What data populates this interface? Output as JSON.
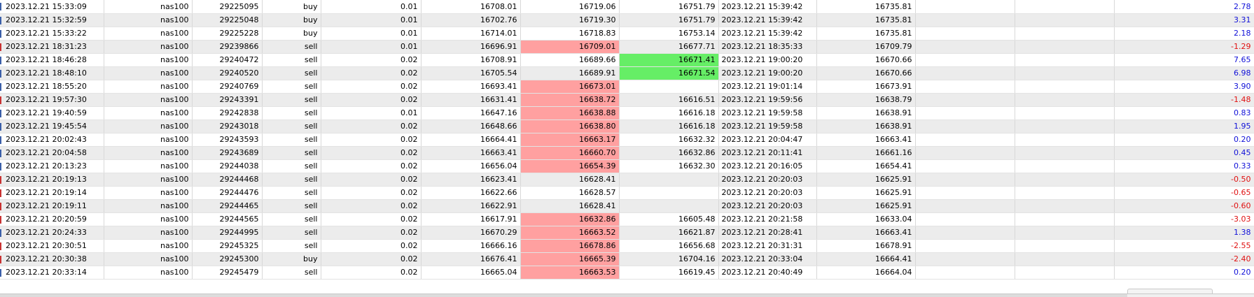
{
  "rows": [
    {
      "open_time": "2023.12.21 15:33:09",
      "symbol": "nas100",
      "ticket": "29225095",
      "type": "buy",
      "volume": "0.01",
      "open_price": "16708.01",
      "sl": "16719.06",
      "tp": "16751.79",
      "close_time": "2023.12.21 15:39:42",
      "close_price": "16735.81",
      "profit": "2.78",
      "sl_highlight": "",
      "tp_highlight": ""
    },
    {
      "open_time": "2023.12.21 15:32:59",
      "symbol": "nas100",
      "ticket": "29225048",
      "type": "buy",
      "volume": "0.01",
      "open_price": "16702.76",
      "sl": "16719.30",
      "tp": "16751.79",
      "close_time": "2023.12.21 15:39:42",
      "close_price": "16735.81",
      "profit": "3.31",
      "sl_highlight": "",
      "tp_highlight": ""
    },
    {
      "open_time": "2023.12.21 15:33:22",
      "symbol": "nas100",
      "ticket": "29225228",
      "type": "buy",
      "volume": "0.01",
      "open_price": "16714.01",
      "sl": "16718.83",
      "tp": "16753.14",
      "close_time": "2023.12.21 15:39:42",
      "close_price": "16735.81",
      "profit": "2.18",
      "sl_highlight": "",
      "tp_highlight": ""
    },
    {
      "open_time": "2023.12.21 18:31:23",
      "symbol": "nas100",
      "ticket": "29239866",
      "type": "sell",
      "volume": "0.01",
      "open_price": "16696.91",
      "sl": "16709.01",
      "tp": "16677.71",
      "close_time": "2023.12.21 18:35:33",
      "close_price": "16709.79",
      "profit": "-1.29",
      "sl_highlight": "red",
      "tp_highlight": ""
    },
    {
      "open_time": "2023.12.21 18:46:28",
      "symbol": "nas100",
      "ticket": "29240472",
      "type": "sell",
      "volume": "0.02",
      "open_price": "16708.91",
      "sl": "16689.66",
      "tp": "16671.41",
      "close_time": "2023.12.21 19:00:20",
      "close_price": "16670.66",
      "profit": "7.65",
      "sl_highlight": "",
      "tp_highlight": "green"
    },
    {
      "open_time": "2023.12.21 18:48:10",
      "symbol": "nas100",
      "ticket": "29240520",
      "type": "sell",
      "volume": "0.02",
      "open_price": "16705.54",
      "sl": "16689.91",
      "tp": "16671.54",
      "close_time": "2023.12.21 19:00:20",
      "close_price": "16670.66",
      "profit": "6.98",
      "sl_highlight": "",
      "tp_highlight": "green"
    },
    {
      "open_time": "2023.12.21 18:55:20",
      "symbol": "nas100",
      "ticket": "29240769",
      "type": "sell",
      "volume": "0.02",
      "open_price": "16693.41",
      "sl": "16673.01",
      "tp": "",
      "close_time": "2023.12.21 19:01:14",
      "close_price": "16673.91",
      "profit": "3.90",
      "sl_highlight": "red",
      "tp_highlight": ""
    },
    {
      "open_time": "2023.12.21 19:57:30",
      "symbol": "nas100",
      "ticket": "29243391",
      "type": "sell",
      "volume": "0.02",
      "open_price": "16631.41",
      "sl": "16638.72",
      "tp": "16616.51",
      "close_time": "2023.12.21 19:59:56",
      "close_price": "16638.79",
      "profit": "-1.48",
      "sl_highlight": "red",
      "tp_highlight": ""
    },
    {
      "open_time": "2023.12.21 19:40:59",
      "symbol": "nas100",
      "ticket": "29242838",
      "type": "sell",
      "volume": "0.01",
      "open_price": "16647.16",
      "sl": "16638.88",
      "tp": "16616.18",
      "close_time": "2023.12.21 19:59:58",
      "close_price": "16638.91",
      "profit": "0.83",
      "sl_highlight": "red",
      "tp_highlight": ""
    },
    {
      "open_time": "2023.12.21 19:45:54",
      "symbol": "nas100",
      "ticket": "29243018",
      "type": "sell",
      "volume": "0.02",
      "open_price": "16648.66",
      "sl": "16638.80",
      "tp": "16616.18",
      "close_time": "2023.12.21 19:59:58",
      "close_price": "16638.91",
      "profit": "1.95",
      "sl_highlight": "red",
      "tp_highlight": ""
    },
    {
      "open_time": "2023.12.21 20:02:43",
      "symbol": "nas100",
      "ticket": "29243593",
      "type": "sell",
      "volume": "0.02",
      "open_price": "16664.41",
      "sl": "16663.17",
      "tp": "16632.32",
      "close_time": "2023.12.21 20:04:47",
      "close_price": "16663.41",
      "profit": "0.20",
      "sl_highlight": "red",
      "tp_highlight": ""
    },
    {
      "open_time": "2023.12.21 20:04:58",
      "symbol": "nas100",
      "ticket": "29243689",
      "type": "sell",
      "volume": "0.02",
      "open_price": "16663.41",
      "sl": "16660.70",
      "tp": "16632.86",
      "close_time": "2023.12.21 20:11:41",
      "close_price": "16661.16",
      "profit": "0.45",
      "sl_highlight": "red",
      "tp_highlight": ""
    },
    {
      "open_time": "2023.12.21 20:13:23",
      "symbol": "nas100",
      "ticket": "29244038",
      "type": "sell",
      "volume": "0.02",
      "open_price": "16656.04",
      "sl": "16654.39",
      "tp": "16632.30",
      "close_time": "2023.12.21 20:16:05",
      "close_price": "16654.41",
      "profit": "0.33",
      "sl_highlight": "red",
      "tp_highlight": ""
    },
    {
      "open_time": "2023.12.21 20:19:13",
      "symbol": "nas100",
      "ticket": "29244468",
      "type": "sell",
      "volume": "0.02",
      "open_price": "16623.41",
      "sl": "16628.41",
      "tp": "",
      "close_time": "2023.12.21 20:20:03",
      "close_price": "16625.91",
      "profit": "-0.50",
      "sl_highlight": "",
      "tp_highlight": ""
    },
    {
      "open_time": "2023.12.21 20:19:14",
      "symbol": "nas100",
      "ticket": "29244476",
      "type": "sell",
      "volume": "0.02",
      "open_price": "16622.66",
      "sl": "16628.57",
      "tp": "",
      "close_time": "2023.12.21 20:20:03",
      "close_price": "16625.91",
      "profit": "-0.65",
      "sl_highlight": "",
      "tp_highlight": ""
    },
    {
      "open_time": "2023.12.21 20:19:11",
      "symbol": "nas100",
      "ticket": "29244465",
      "type": "sell",
      "volume": "0.02",
      "open_price": "16622.91",
      "sl": "16628.41",
      "tp": "",
      "close_time": "2023.12.21 20:20:03",
      "close_price": "16625.91",
      "profit": "-0.60",
      "sl_highlight": "",
      "tp_highlight": ""
    },
    {
      "open_time": "2023.12.21 20:20:59",
      "symbol": "nas100",
      "ticket": "29244565",
      "type": "sell",
      "volume": "0.02",
      "open_price": "16617.91",
      "sl": "16632.86",
      "tp": "16605.48",
      "close_time": "2023.12.21 20:21:58",
      "close_price": "16633.04",
      "profit": "-3.03",
      "sl_highlight": "red",
      "tp_highlight": ""
    },
    {
      "open_time": "2023.12.21 20:24:33",
      "symbol": "nas100",
      "ticket": "29244995",
      "type": "sell",
      "volume": "0.02",
      "open_price": "16670.29",
      "sl": "16663.52",
      "tp": "16621.87",
      "close_time": "2023.12.21 20:28:41",
      "close_price": "16663.41",
      "profit": "1.38",
      "sl_highlight": "red",
      "tp_highlight": ""
    },
    {
      "open_time": "2023.12.21 20:30:51",
      "symbol": "nas100",
      "ticket": "29245325",
      "type": "sell",
      "volume": "0.02",
      "open_price": "16666.16",
      "sl": "16678.86",
      "tp": "16656.68",
      "close_time": "2023.12.21 20:31:31",
      "close_price": "16678.91",
      "profit": "-2.55",
      "sl_highlight": "red",
      "tp_highlight": ""
    },
    {
      "open_time": "2023.12.21 20:30:38",
      "symbol": "nas100",
      "ticket": "29245300",
      "type": "buy",
      "volume": "0.02",
      "open_price": "16676.41",
      "sl": "16665.39",
      "tp": "16704.16",
      "close_time": "2023.12.21 20:33:04",
      "close_price": "16664.41",
      "profit": "-2.40",
      "sl_highlight": "red",
      "tp_highlight": ""
    },
    {
      "open_time": "2023.12.21 20:33:14",
      "symbol": "nas100",
      "ticket": "29245479",
      "type": "sell",
      "volume": "0.02",
      "open_price": "16665.04",
      "sl": "16663.53",
      "tp": "16619.45",
      "close_time": "2023.12.21 20:40:49",
      "close_price": "16664.04",
      "profit": "0.20",
      "sl_highlight": "red",
      "tp_highlight": ""
    }
  ]
}
